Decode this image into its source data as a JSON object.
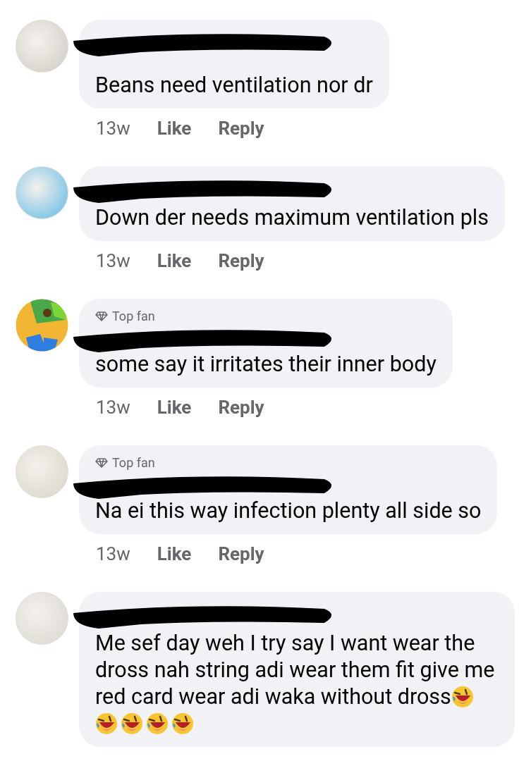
{
  "comments": [
    {
      "kind": "plain",
      "text": "Beans need ventilation nor dr",
      "time": "13w",
      "actions": [
        "Like",
        "Reply"
      ]
    },
    {
      "kind": "plain",
      "text": "Down der needs maximum ventilation pls",
      "time": "13w",
      "actions": [
        "Like",
        "Reply"
      ]
    },
    {
      "kind": "plain",
      "badge": "Top fan",
      "text": "some say it irritates their inner body",
      "time": "13w",
      "actions": [
        "Like",
        "Reply"
      ]
    },
    {
      "kind": "plain",
      "badge": "Top fan",
      "text": "Na ei this way infection plenty all side so",
      "time": "13w",
      "actions": [
        "Like",
        "Reply"
      ]
    },
    {
      "kind": "laughing",
      "text": "Me sef day weh I try say I want wear the dross nah string adi wear them fit give me red card wear adi waka without dross"
    }
  ]
}
